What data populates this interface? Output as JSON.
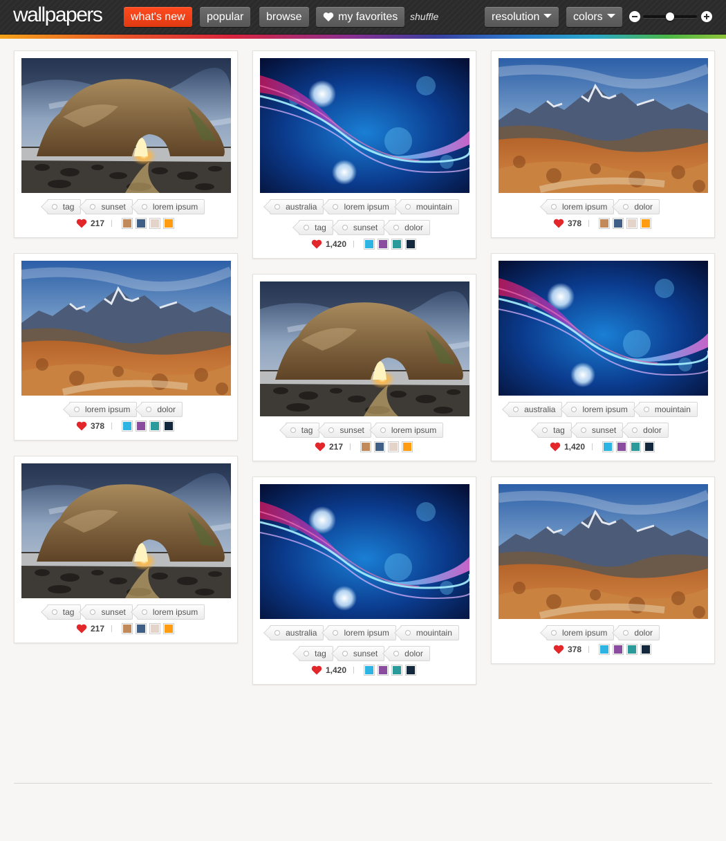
{
  "header": {
    "logo": "wallpapers",
    "nav": [
      {
        "label": "what's new"
      },
      {
        "label": "popular"
      },
      {
        "label": "browse"
      },
      {
        "label": "my favorites"
      }
    ],
    "shuffle": "shuffle",
    "resolution": "resolution",
    "colors": "colors",
    "zoom_level": 0.5
  },
  "palettes": {
    "warm": [
      "#c28a5a",
      "#3f5f86",
      "#e3d3c9",
      "#ff9c12"
    ],
    "cool": [
      "#2eb4e3",
      "#8a4c9e",
      "#2a9a9b",
      "#14283d"
    ]
  },
  "cards": [
    {
      "image": "rock-arch",
      "tags": [
        [
          "tag",
          "sunset",
          "lorem ipsum"
        ]
      ],
      "likes": "217",
      "palette": "warm"
    },
    {
      "image": "mountains",
      "tags": [
        [
          "lorem ipsum",
          "dolor"
        ]
      ],
      "likes": "378",
      "palette": "cool"
    },
    {
      "image": "rock-arch",
      "tags": [
        [
          "tag",
          "sunset",
          "lorem ipsum"
        ]
      ],
      "likes": "217",
      "palette": "warm"
    },
    {
      "image": "abstract-wave",
      "tags": [
        [
          "australia",
          "lorem ipsum",
          "mouintain"
        ],
        [
          "tag",
          "sunset",
          "dolor"
        ]
      ],
      "likes": "1,420",
      "palette": "cool"
    },
    {
      "image": "rock-arch",
      "tags": [
        [
          "tag",
          "sunset",
          "lorem ipsum"
        ]
      ],
      "likes": "217",
      "palette": "warm"
    },
    {
      "image": "abstract-wave",
      "tags": [
        [
          "australia",
          "lorem ipsum",
          "mouintain"
        ],
        [
          "tag",
          "sunset",
          "dolor"
        ]
      ],
      "likes": "1,420",
      "palette": "cool"
    },
    {
      "image": "mountains",
      "tags": [
        [
          "lorem ipsum",
          "dolor"
        ]
      ],
      "likes": "378",
      "palette": "warm"
    },
    {
      "image": "abstract-wave",
      "tags": [
        [
          "australia",
          "lorem ipsum",
          "mouintain"
        ],
        [
          "tag",
          "sunset",
          "dolor"
        ]
      ],
      "likes": "1,420",
      "palette": "cool"
    },
    {
      "image": "mountains",
      "tags": [
        [
          "lorem ipsum",
          "dolor"
        ]
      ],
      "likes": "378",
      "palette": "cool"
    }
  ]
}
